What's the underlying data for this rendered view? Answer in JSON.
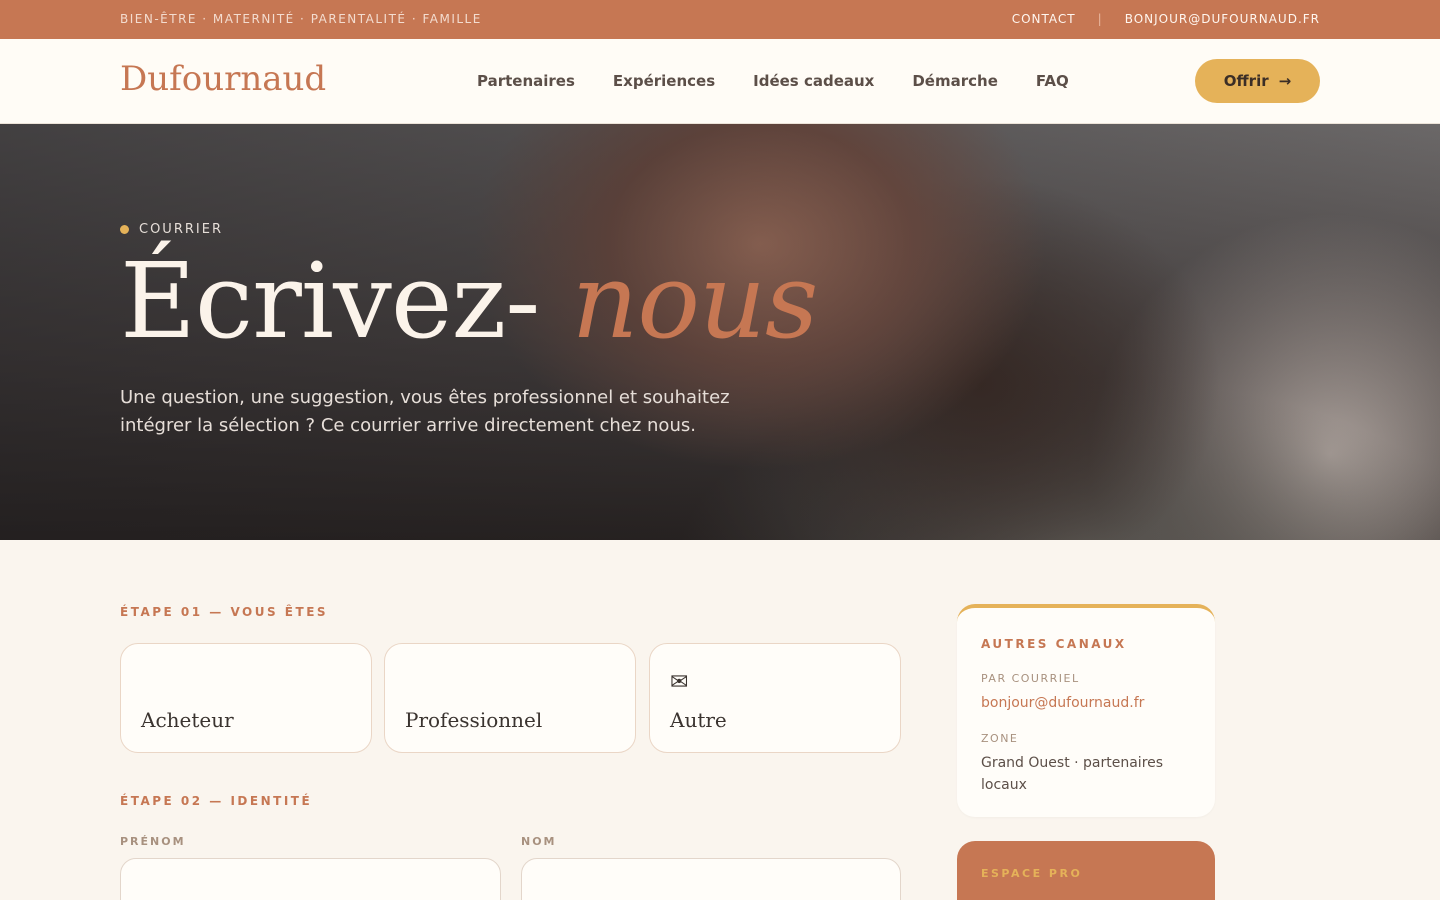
{
  "topbar": {
    "tags": "BIEN-ÊTRE · MATERNITÉ · PARENTALITÉ · FAMILLE",
    "contact": "CONTACT",
    "separator": "|",
    "email": "BONJOUR@DUFOURNAUD.FR"
  },
  "header": {
    "logo": "Dufournaud",
    "nav": [
      "Partenaires",
      "Expériences",
      "Idées cadeaux",
      "Démarche",
      "FAQ"
    ],
    "cta_label": "Offrir",
    "cta_arrow": "→"
  },
  "hero": {
    "kicker": "COURRIER",
    "title_main": "Écrivez-",
    "title_accent": "nous",
    "intro": "Une question, une suggestion, vous êtes professionnel et souhaitez intégrer la sélection ? Ce courrier arrive directement chez nous."
  },
  "step1": {
    "label": "ÉTAPE 01 — VOUS ÊTES",
    "choices": [
      {
        "icon": "gift-icon",
        "glyph": "",
        "label": "Acheteur"
      },
      {
        "icon": "briefcase-icon",
        "glyph": "",
        "label": "Professionnel"
      },
      {
        "icon": "envelope-icon",
        "glyph": "✉",
        "label": "Autre"
      }
    ]
  },
  "step2": {
    "label": "ÉTAPE 02 — IDENTITÉ",
    "firstname_label": "PRÉNOM",
    "lastname_label": "NOM"
  },
  "sidebar": {
    "title": "AUTRES CANAUX",
    "mail_label": "PAR COURRIEL",
    "mail_value": "bonjour@dufournaud.fr",
    "zone_label": "ZONE",
    "zone_value": "Grand Ouest · partenaires locaux",
    "pro_title": "ESPACE PRO"
  },
  "colors": {
    "accent": "#c67753",
    "gold": "#e5b259",
    "background": "#faf5ee"
  }
}
